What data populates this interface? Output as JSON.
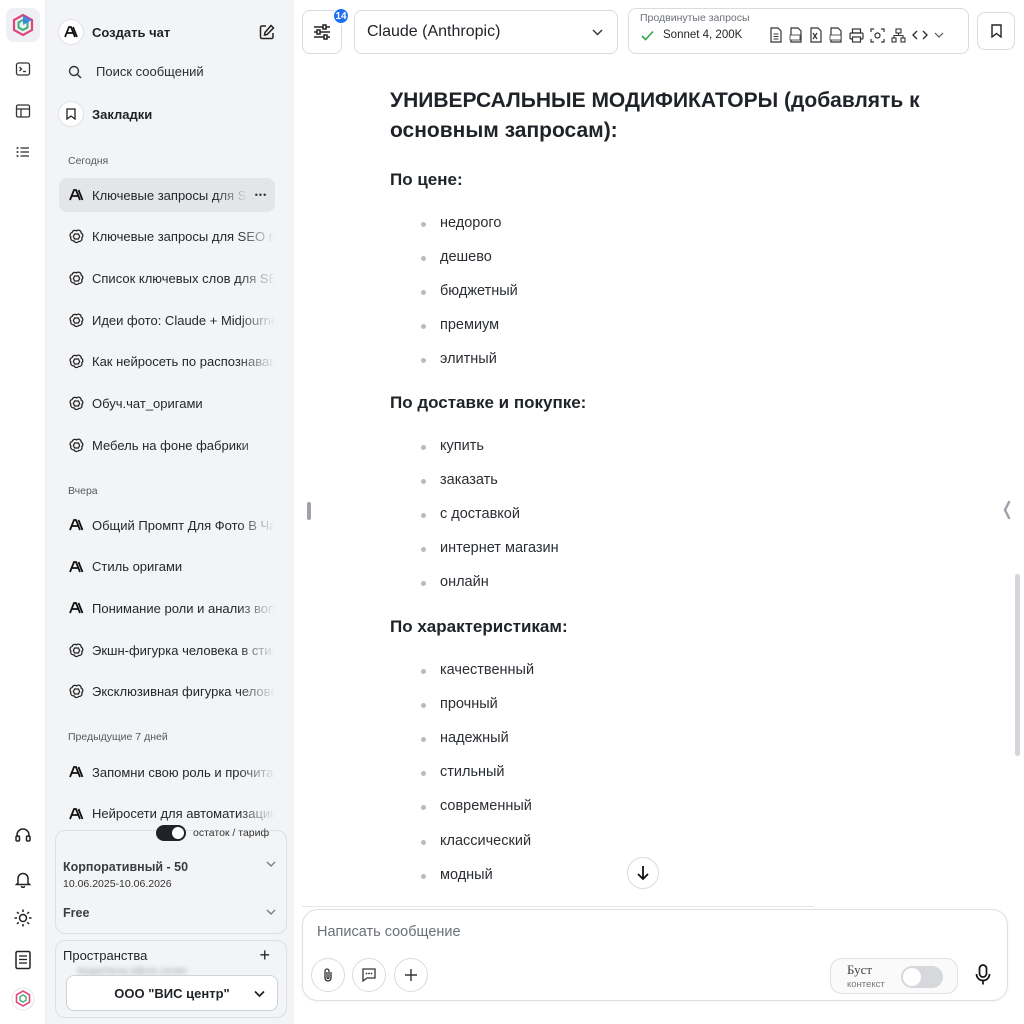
{
  "rail": {
    "items": [
      {
        "name": "terminal-icon"
      },
      {
        "name": "table-icon"
      },
      {
        "name": "list-icon"
      }
    ],
    "bottom": [
      {
        "name": "headset-icon"
      },
      {
        "name": "bell-icon"
      },
      {
        "name": "sun-icon"
      },
      {
        "name": "document-icon"
      }
    ]
  },
  "sidebar": {
    "new_chat": "Создать чат",
    "search": "Поиск сообщений",
    "bookmarks": "Закладки",
    "sections": {
      "today": "Сегодня",
      "yesterday": "Вчера",
      "week": "Предыдущие 7 дней"
    },
    "today_chats": [
      {
        "label": "Ключевые запросы для SEO",
        "icon": "anthropic"
      },
      {
        "label": "Ключевые запросы для SEO продвижения",
        "icon": "openai"
      },
      {
        "label": "Список ключевых слов для SEO",
        "icon": "openai"
      },
      {
        "label": "Идеи фото: Claude + Midjourney",
        "icon": "openai"
      },
      {
        "label": "Как нейросеть по распознаванию",
        "icon": "openai"
      },
      {
        "label": "Обуч.чат_оригами",
        "icon": "openai"
      },
      {
        "label": "Мебель на фоне фабрики",
        "icon": "openai"
      }
    ],
    "yesterday_chats": [
      {
        "label": "Общий Промпт Для Фото В Чат",
        "icon": "anthropic"
      },
      {
        "label": "Стиль оригами",
        "icon": "anthropic"
      },
      {
        "label": "Понимание роли и анализ вопроса",
        "icon": "anthropic"
      },
      {
        "label": "Экшн-фигурка человека в стиле",
        "icon": "openai"
      },
      {
        "label": "Эксклюзивная фигурка человека",
        "icon": "openai"
      }
    ],
    "week_chats": [
      {
        "label": "Запомни свою роль и прочитай",
        "icon": "anthropic"
      },
      {
        "label": "Нейросети для автоматизации",
        "icon": "anthropic"
      }
    ],
    "plan": {
      "toggle_label": "остаток / тариф",
      "name": "Корпоративный - 50",
      "dates": "10.06.2025-10.06.2026",
      "free": "Free"
    },
    "spaces": {
      "title": "Пространства",
      "email": "bogacheva.s@vis.center",
      "org": "ООО \"ВИС центр\""
    }
  },
  "header": {
    "badge": "14",
    "model": "Claude (Anthropic)",
    "advanced_label": "Продвинутые запросы",
    "advanced_value": "Sonnet 4, 200K"
  },
  "content": {
    "heading": "УНИВЕРСАЛЬНЫЕ МОДИФИКАТОРЫ (добавлять к основным запросам):",
    "sections": [
      {
        "title": "По цене:",
        "items": [
          "недорого",
          "дешево",
          "бюджетный",
          "премиум",
          "элитный"
        ]
      },
      {
        "title": "По доставке и покупке:",
        "items": [
          "купить",
          "заказать",
          "с доставкой",
          "интернет магазин",
          "онлайн"
        ]
      },
      {
        "title": "По характеристикам:",
        "items": [
          "качественный",
          "прочный",
          "надежный",
          "стильный",
          "современный",
          "классический",
          "модный"
        ]
      }
    ]
  },
  "composer": {
    "placeholder": "Написать сообщение",
    "boost_label": "Буст",
    "boost_sub": "контекст"
  },
  "colors": {
    "accent": "#1e6ff1",
    "sidebar_bg": "#f3f4f6",
    "check": "#2da44e"
  }
}
